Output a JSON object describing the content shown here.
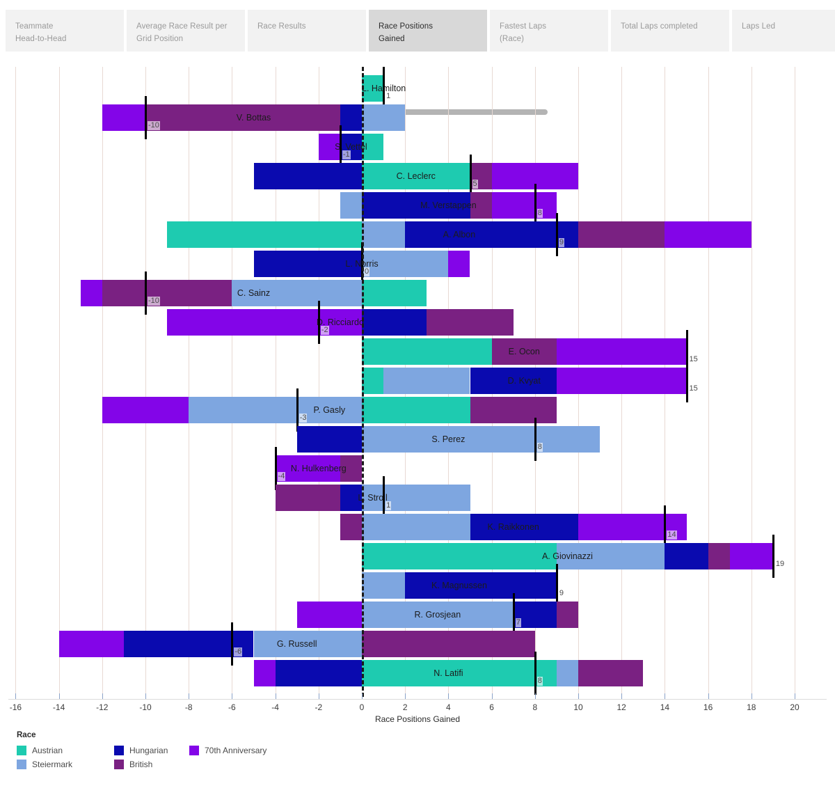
{
  "tabs": [
    {
      "label": "Teammate\nHead-to-Head",
      "active": false
    },
    {
      "label": "Average Race Result per\nGrid Position",
      "active": false
    },
    {
      "label": "Race Results",
      "active": false
    },
    {
      "label": "Race Positions\nGained",
      "active": true
    },
    {
      "label": "Fastest Laps\n(Race)",
      "active": false
    },
    {
      "label": "Total Laps completed",
      "active": false
    },
    {
      "label": "Laps Led",
      "active": false
    }
  ],
  "legend": {
    "title": "Race",
    "entries": [
      {
        "label": "Austrian",
        "color": "#1ECBB0"
      },
      {
        "label": "Steiermark",
        "color": "#7EA6E0"
      },
      {
        "label": "Hungarian",
        "color": "#0A0AAF"
      },
      {
        "label": "British",
        "color": "#7A2182"
      },
      {
        "label": "70th Anniversary",
        "color": "#8305E8"
      }
    ]
  },
  "chart_data": {
    "type": "bar",
    "orientation": "horizontal",
    "stacked": true,
    "title": "Race Positions Gained",
    "xlabel": "Race Positions Gained",
    "ylabel": "",
    "xlim": [
      -16.5,
      20.5
    ],
    "xticks": [
      -16,
      -14,
      -12,
      -10,
      -8,
      -6,
      -4,
      -2,
      0,
      2,
      4,
      6,
      8,
      10,
      12,
      14,
      16,
      18,
      20
    ],
    "grid": "vertical",
    "legend_position": "bottom-left",
    "series": [
      "Austrian",
      "Steiermark",
      "Hungarian",
      "British",
      "70th Anniversary"
    ],
    "zero_reference_line": 0,
    "categories": [
      "L. Hamilton",
      "V. Bottas",
      "S. Vettel",
      "C. Leclerc",
      "M. Verstappen",
      "A. Albon",
      "L. Norris",
      "C. Sainz",
      "D. Ricciardo",
      "E. Ocon",
      "D. Kvyat",
      "P. Gasly",
      "S. Perez",
      "N. Hulkenberg",
      "L. Stroll",
      "K. Raikkonen",
      "A. Giovinazzi",
      "K. Magnussen",
      "R. Grosjean",
      "G. Russell",
      "N. Latifi"
    ],
    "rows": [
      {
        "driver": "L. Hamilton",
        "total": 1,
        "neg": [],
        "pos": [
          {
            "race": "Austrian",
            "v": 1
          }
        ]
      },
      {
        "driver": "V. Bottas",
        "total": -10,
        "neg": [
          {
            "race": "Hungarian",
            "v": 1
          },
          {
            "race": "British",
            "v": 9
          },
          {
            "race": "70th Anniversary",
            "v": 2
          }
        ],
        "pos": [
          {
            "race": "Steiermark",
            "v": 2
          }
        ]
      },
      {
        "driver": "S. Vettel",
        "total": -1,
        "neg": [
          {
            "race": "Hungarian",
            "v": 1
          },
          {
            "race": "70th Anniversary",
            "v": 1
          }
        ],
        "pos": [
          {
            "race": "Austrian",
            "v": 1
          }
        ]
      },
      {
        "driver": "C. Leclerc",
        "total": 5,
        "neg": [
          {
            "race": "Hungarian",
            "v": 5
          }
        ],
        "pos": [
          {
            "race": "Austrian",
            "v": 5
          },
          {
            "race": "British",
            "v": 1
          },
          {
            "race": "70th Anniversary",
            "v": 4
          }
        ]
      },
      {
        "driver": "M. Verstappen",
        "total": 8,
        "neg": [
          {
            "race": "Steiermark",
            "v": 1
          }
        ],
        "pos": [
          {
            "race": "Hungarian",
            "v": 5
          },
          {
            "race": "British",
            "v": 1
          },
          {
            "race": "70th Anniversary",
            "v": 3
          }
        ]
      },
      {
        "driver": "A. Albon",
        "total": 9,
        "neg": [
          {
            "race": "Austrian",
            "v": 9
          }
        ],
        "pos": [
          {
            "race": "Steiermark",
            "v": 2
          },
          {
            "race": "Hungarian",
            "v": 8
          },
          {
            "race": "British",
            "v": 4
          },
          {
            "race": "70th Anniversary",
            "v": 4
          }
        ]
      },
      {
        "driver": "L. Norris",
        "total": 0,
        "neg": [
          {
            "race": "Hungarian",
            "v": 5
          }
        ],
        "pos": [
          {
            "race": "Steiermark",
            "v": 4
          },
          {
            "race": "70th Anniversary",
            "v": 1
          }
        ]
      },
      {
        "driver": "C. Sainz",
        "total": -10,
        "neg": [
          {
            "race": "Steiermark",
            "v": 6
          },
          {
            "race": "British",
            "v": 6
          },
          {
            "race": "70th Anniversary",
            "v": 1
          }
        ],
        "pos": [
          {
            "race": "Austrian",
            "v": 3
          }
        ]
      },
      {
        "driver": "D. Ricciardo",
        "total": -2,
        "neg": [
          {
            "race": "70th Anniversary",
            "v": 9
          }
        ],
        "pos": [
          {
            "race": "Hungarian",
            "v": 3
          },
          {
            "race": "British",
            "v": 4
          }
        ]
      },
      {
        "driver": "E. Ocon",
        "total": 15,
        "neg": [],
        "pos": [
          {
            "race": "Austrian",
            "v": 6
          },
          {
            "race": "British",
            "v": 3
          },
          {
            "race": "70th Anniversary",
            "v": 6
          }
        ]
      },
      {
        "driver": "D. Kvyat",
        "total": 15,
        "neg": [],
        "pos": [
          {
            "race": "Austrian",
            "v": 1
          },
          {
            "race": "Steiermark",
            "v": 4
          },
          {
            "race": "Hungarian",
            "v": 4
          },
          {
            "race": "70th Anniversary",
            "v": 6
          }
        ]
      },
      {
        "driver": "P. Gasly",
        "total": -3,
        "neg": [
          {
            "race": "Steiermark",
            "v": 8
          },
          {
            "race": "70th Anniversary",
            "v": 4
          }
        ],
        "pos": [
          {
            "race": "Austrian",
            "v": 5
          },
          {
            "race": "British",
            "v": 4
          }
        ]
      },
      {
        "driver": "S. Perez",
        "total": 8,
        "neg": [
          {
            "race": "Hungarian",
            "v": 3
          }
        ],
        "pos": [
          {
            "race": "Steiermark",
            "v": 11
          }
        ]
      },
      {
        "driver": "N. Hulkenberg",
        "total": -4,
        "neg": [
          {
            "race": "British",
            "v": 1
          },
          {
            "race": "70th Anniversary",
            "v": 3
          }
        ],
        "pos": []
      },
      {
        "driver": "L. Stroll",
        "total": 1,
        "neg": [
          {
            "race": "Hungarian",
            "v": 1
          },
          {
            "race": "British",
            "v": 3
          }
        ],
        "pos": [
          {
            "race": "Steiermark",
            "v": 5
          }
        ]
      },
      {
        "driver": "K. Raikkonen",
        "total": 14,
        "neg": [
          {
            "race": "British",
            "v": 1
          }
        ],
        "pos": [
          {
            "race": "Steiermark",
            "v": 5
          },
          {
            "race": "Hungarian",
            "v": 5
          },
          {
            "race": "70th Anniversary",
            "v": 5
          }
        ]
      },
      {
        "driver": "A. Giovinazzi",
        "total": 19,
        "neg": [],
        "pos": [
          {
            "race": "Austrian",
            "v": 9
          },
          {
            "race": "Steiermark",
            "v": 5
          },
          {
            "race": "Hungarian",
            "v": 2
          },
          {
            "race": "British",
            "v": 1
          },
          {
            "race": "70th Anniversary",
            "v": 2
          }
        ]
      },
      {
        "driver": "K. Magnussen",
        "total": 9,
        "neg": [],
        "pos": [
          {
            "race": "Steiermark",
            "v": 2
          },
          {
            "race": "Hungarian",
            "v": 7
          }
        ]
      },
      {
        "driver": "R. Grosjean",
        "total": 7,
        "neg": [
          {
            "race": "70th Anniversary",
            "v": 3
          }
        ],
        "pos": [
          {
            "race": "Steiermark",
            "v": 7
          },
          {
            "race": "Hungarian",
            "v": 2
          },
          {
            "race": "British",
            "v": 1
          }
        ]
      },
      {
        "driver": "G. Russell",
        "total": -6,
        "neg": [
          {
            "race": "Steiermark",
            "v": 5
          },
          {
            "race": "Hungarian",
            "v": 6
          },
          {
            "race": "70th Anniversary",
            "v": 3
          }
        ],
        "pos": [
          {
            "race": "British",
            "v": 8
          }
        ]
      },
      {
        "driver": "N. Latifi",
        "total": 8,
        "neg": [
          {
            "race": "Hungarian",
            "v": 4
          },
          {
            "race": "70th Anniversary",
            "v": 1
          }
        ],
        "pos": [
          {
            "race": "Austrian",
            "v": 9
          },
          {
            "race": "Steiermark",
            "v": 1
          },
          {
            "race": "British",
            "v": 3
          }
        ]
      }
    ]
  }
}
